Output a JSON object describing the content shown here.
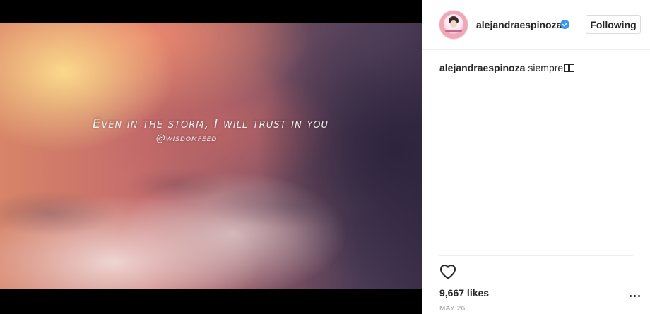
{
  "post": {
    "image_quote": "Even in the storm, I will trust in you",
    "image_handle": "@wisdomfeed"
  },
  "header": {
    "username": "alejandraespinoza",
    "verified": true,
    "follow_label": "Following"
  },
  "caption": {
    "username": "alejandraespinoza",
    "text": "siempre"
  },
  "actions": {
    "like_icon": "heart-outline-icon",
    "more_icon": "ellipsis-icon"
  },
  "stats": {
    "likes": "9,667 likes",
    "date": "MAY 26"
  },
  "colors": {
    "verified_badge": "#3897f0",
    "text": "#262626",
    "muted": "#999999"
  }
}
